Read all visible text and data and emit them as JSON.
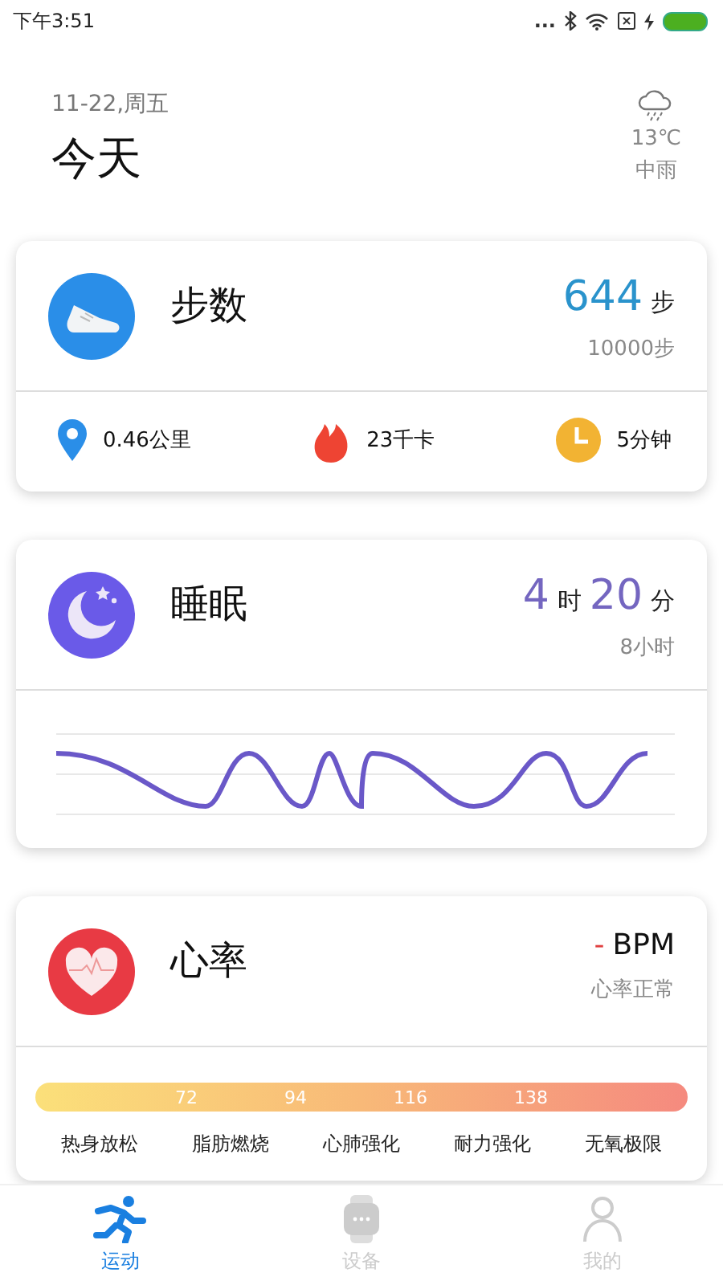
{
  "status_bar": {
    "time": "下午3:51",
    "dots": "..."
  },
  "header": {
    "date": "11-22,周五",
    "title": "今天",
    "weather": {
      "temperature": "13℃",
      "condition": "中雨"
    }
  },
  "steps": {
    "title": "步数",
    "value": "644",
    "unit": "步",
    "goal": "10000步",
    "stats": [
      {
        "kind": "distance",
        "text": "0.46公里"
      },
      {
        "kind": "calories",
        "text": "23千卡"
      },
      {
        "kind": "time",
        "text": "5分钟"
      }
    ]
  },
  "sleep": {
    "title": "睡眠",
    "hours": "4",
    "hours_unit": "时",
    "minutes": "20",
    "minutes_unit": "分",
    "goal": "8小时"
  },
  "heart": {
    "title": "心率",
    "value": "-",
    "unit": "BPM",
    "status": "心率正常",
    "ticks": [
      "72",
      "94",
      "116",
      "138"
    ],
    "zones": [
      "热身放松",
      "脂肪燃烧",
      "心肺强化",
      "耐力强化",
      "无氧极限"
    ]
  },
  "nav": [
    {
      "kind": "run",
      "label": "运动",
      "selected": true
    },
    {
      "kind": "watch",
      "label": "设备",
      "selected": false
    },
    {
      "kind": "person",
      "label": "我的",
      "selected": false
    }
  ]
}
